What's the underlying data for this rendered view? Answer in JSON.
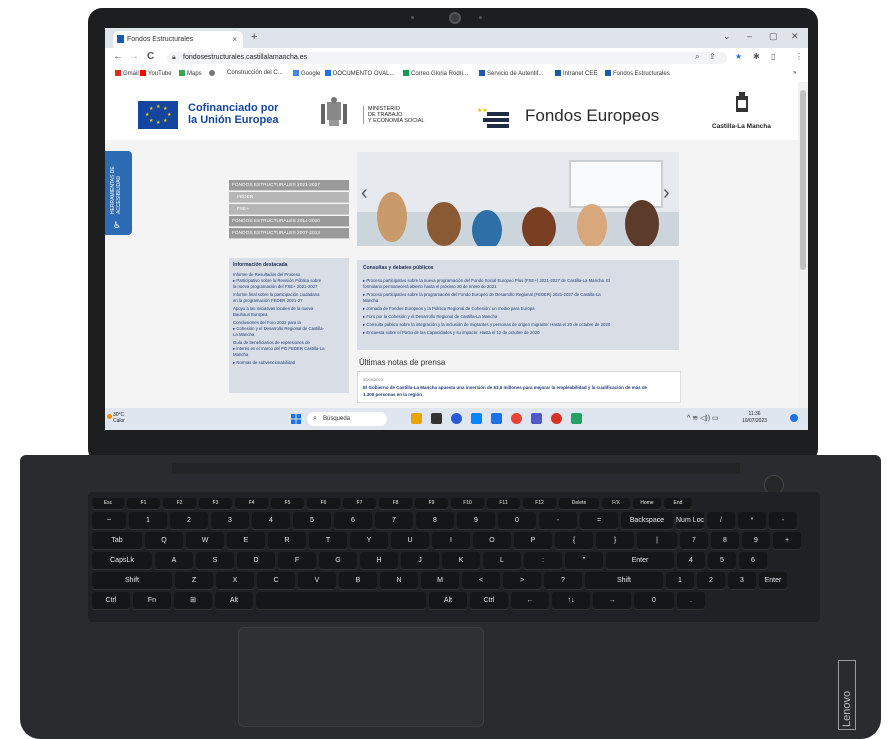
{
  "browser": {
    "tab_title": "Fondos Estructurales",
    "tab_close": "×",
    "new_tab": "+",
    "url": "fondosestructurales.castillalamancha.es",
    "nav_back": "←",
    "nav_forward": "→",
    "nav_reload": "C",
    "window_controls": [
      "⌄",
      "–",
      "▢",
      "✕"
    ],
    "bookmarks": [
      {
        "label": "Gmail",
        "color": "#d93025"
      },
      {
        "label": "YouTube",
        "color": "#ff0000"
      },
      {
        "label": "Maps",
        "color": "#34a853"
      },
      {
        "label": "Construcción del C...",
        "color": "#555555"
      },
      {
        "label": "Google",
        "color": "#4285f4"
      },
      {
        "label": "DOCUMENTO OVAL...",
        "color": "#1a73e8"
      },
      {
        "label": "Correo Gloria Rodri...",
        "color": "#0f9d58"
      },
      {
        "label": "Servicio de Autentif...",
        "color": "#1a5aa8"
      },
      {
        "label": "Intranet CEE",
        "color": "#1a5aa8"
      },
      {
        "label": "Fondos Estructurales",
        "color": "#1a5aa8"
      }
    ]
  },
  "site": {
    "eu_text_1": "Cofinanciado por",
    "eu_text_2": "la Unión Europea",
    "ministry_1": "MINISTERIO",
    "ministry_2": "DE TRABAJO",
    "ministry_3": "Y ECONOMÍA SOCIAL",
    "fondos_europeos": "Fondos Europeos",
    "clm": "Castilla-La Mancha",
    "accessibility_label": "HERRAMIENTAS DE ACCESIBILIDAD",
    "left_nav": [
      "FONDOS ESTRUCTURALES 2021-2027",
      "FEDER",
      "FSE+",
      "FONDOS ESTRUCTURALES 2014-2020",
      "FONDOS ESTRUCTURALES 2007-2013"
    ],
    "info_title": "Información destacada",
    "info_items": [
      "Informe de Resultados del Proceso",
      "▸ Participativo sobre la Revisión Pública sobre",
      "  la nueva programación del FSE+ 2021-2027",
      "  Informe final sobre la participación ciudadana",
      "  en la programación FEDER 2021-27",
      "  Apoyo a las iniciativas locales de la nueva",
      "  Bauhaus Europea",
      "  Conclusiones del Foro 2022 para la",
      "▸ Cohesión y el Desarrollo Regional de Castilla-",
      "  La Mancha",
      "  Guía de beneficiarios de expresiones de",
      "▸ interés en el marco del PO FEDER Castilla-La",
      "  Mancha",
      "▸ Normas de subvencionabilidad"
    ],
    "consult_title": "Consultas y debates públicos",
    "consult_items": [
      "▸ Proceso participativo sobre la nueva programación del Fondo Social Europeo Plus (FSE+) 2021-2027 de Castilla-La Mancha. El",
      "  formulario permanecerá abierto hasta el próximo 20 de enero de 2021",
      "▸ Proceso participativo sobre la programación del Fondo Europeo de Desarrollo Regional (FEDER) 2021-2027 de Castilla-La",
      "  Mancha",
      "▸ Jornada de Fondos Europeos y la Política Regional de Cohesión: un medio para Europa",
      "▸ Foro por la Cohesión y el Desarrollo Regional de Castilla-La Mancha",
      "▸ Consulta pública sobre la integración y la inclusión de migrantes y personas de origen migrante: Hasta el 20 de octubre de 2020",
      "▸ Encuesta sobre el Pacto de las Capacidades y su impacto: Hasta el 12 de octubre de 2020"
    ],
    "notas_title": "Últimas notas de prensa",
    "notas_date": "30/05/2023",
    "notas_line_1": "El Gobierno de Castilla-La Mancha apuesta una inversión de 53,5 millones para mejorar la empleabilidad y la cualificación de más de",
    "notas_line_2": "1.300 personas en la región"
  },
  "taskbar": {
    "weather_temp": "30°C",
    "weather_desc": "Calor",
    "search_placeholder": "Búsqueda",
    "time": "11:36",
    "date": "10/07/2023",
    "tray": "^  ≋  ◁))  ▭"
  },
  "laptop": {
    "brand": "Lenovo"
  },
  "keyboard": {
    "row0": [
      "Esc",
      "F1",
      "F2",
      "F3",
      "F4",
      "F5",
      "F6",
      "F7",
      "F8",
      "F9",
      "F10",
      "F11",
      "F12",
      "Delete",
      "F/X",
      "Home",
      "End"
    ],
    "row1": [
      "~",
      "1",
      "2",
      "3",
      "4",
      "5",
      "6",
      "7",
      "8",
      "9",
      "0",
      "-",
      "=",
      "Backspace",
      "Num Lock",
      "/",
      "*",
      "-"
    ],
    "row2": [
      "Tab",
      "Q",
      "W",
      "E",
      "R",
      "T",
      "Y",
      "U",
      "I",
      "O",
      "P",
      "{",
      "}",
      "|",
      "7",
      "8",
      "9",
      "+"
    ],
    "row3": [
      "CapsLk",
      "A",
      "S",
      "D",
      "F",
      "G",
      "H",
      "J",
      "K",
      "L",
      ":",
      "\"",
      "Enter",
      "4",
      "5",
      "6"
    ],
    "row4": [
      "Shift",
      "Z",
      "X",
      "C",
      "V",
      "B",
      "N",
      "M",
      "<",
      ">",
      "?",
      "Shift",
      "1",
      "2",
      "3",
      "Enter"
    ],
    "row5": [
      "Ctrl",
      "Fn",
      "⊞",
      "Alt",
      "",
      "Alt",
      "Ctrl",
      "←",
      "↑↓",
      "→",
      "0",
      "."
    ]
  }
}
